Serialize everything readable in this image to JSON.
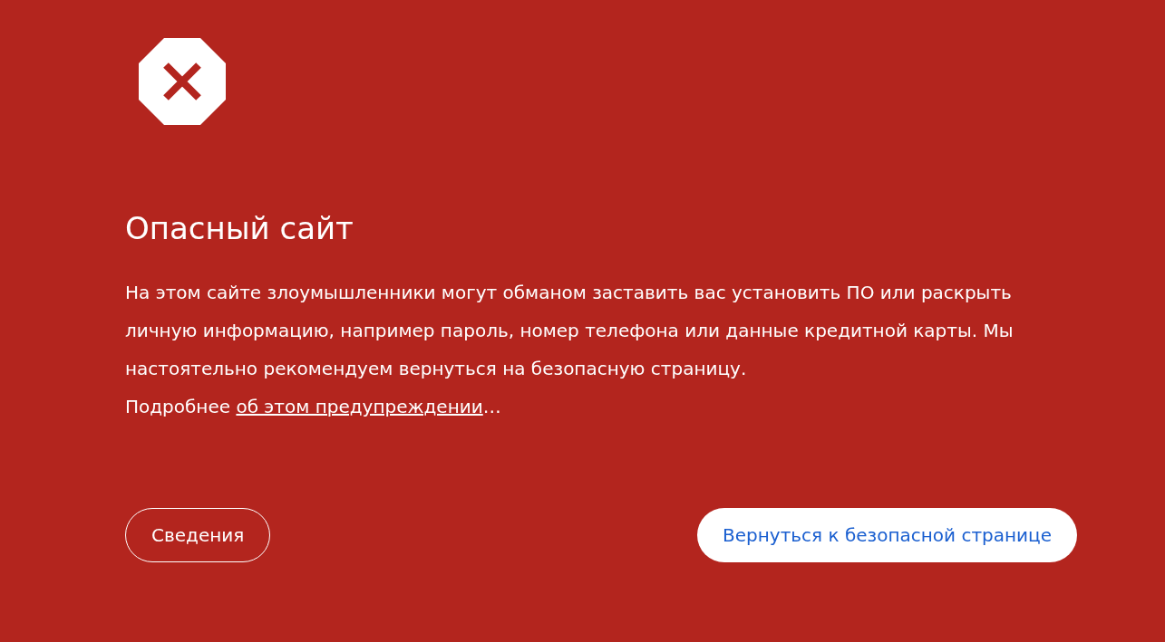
{
  "title": "Опасный сайт",
  "message": {
    "text": "На этом сайте злоумышленники могут обманом заставить вас установить ПО или раскрыть личную информацию, например пароль, номер телефона или данные кредитной карты. Мы настоятельно рекомендуем вернуться на безопасную страницу.",
    "more_prefix": "Подробнее",
    "link": "об этом предупреждении",
    "suffix": "…"
  },
  "buttons": [
    {
      "label": "Сведения",
      "kind": "outline"
    },
    {
      "label": "Вернуться к безопасной странице",
      "kind": "primary"
    }
  ]
}
